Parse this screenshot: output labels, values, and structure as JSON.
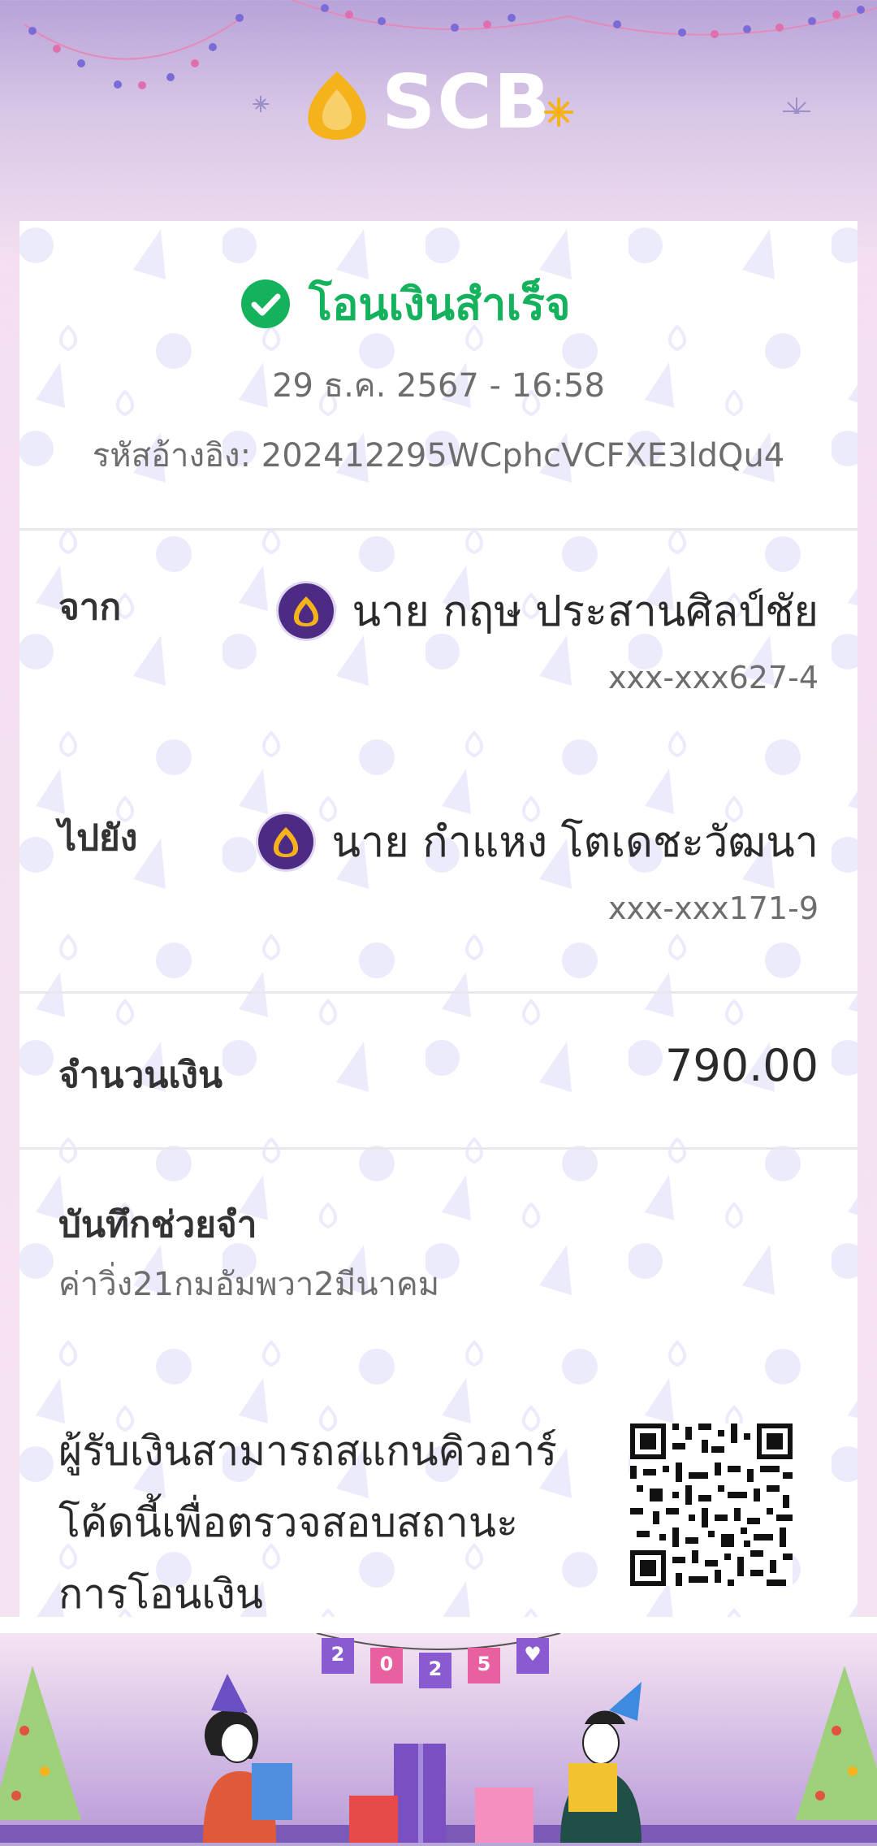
{
  "brand": {
    "logo_text": "SCB",
    "logo_color": "#f5b21b",
    "accent": "#4d2a83"
  },
  "status": {
    "text": "โอนเงินสำเร็จ",
    "color": "#15b25d",
    "icon": "check-circle-icon"
  },
  "transaction": {
    "datetime": "29 ธ.ค. 2567 - 16:58",
    "reference_label": "รหัสอ้างอิง:",
    "reference_value": "202412295WCphcVCFXE3ldQu4"
  },
  "from": {
    "label": "จาก",
    "name": "นาย กฤษ  ประสานศิลป์ชัย",
    "account": "xxx-xxx627-4",
    "icon": "scb-bank-icon"
  },
  "to": {
    "label": "ไปยัง",
    "name": "นาย กำแหง โตเดชะวัฒนา",
    "account": "xxx-xxx171-9",
    "icon": "scb-bank-icon"
  },
  "amount": {
    "label": "จำนวนเงิน",
    "value": "790.00"
  },
  "memo": {
    "label": "บันทึกช่วยจำ",
    "value": "ค่าวิ่ง21กมอัมพวา2มีนาคม"
  },
  "qr": {
    "text": "ผู้รับเงินสามารถสแกนคิวอาร์โค้ดนี้เพื่อตรวจสอบสถานะการโอนเงิน"
  },
  "footer": {
    "banner": [
      "2",
      "0",
      "2",
      "5",
      "♥"
    ]
  }
}
